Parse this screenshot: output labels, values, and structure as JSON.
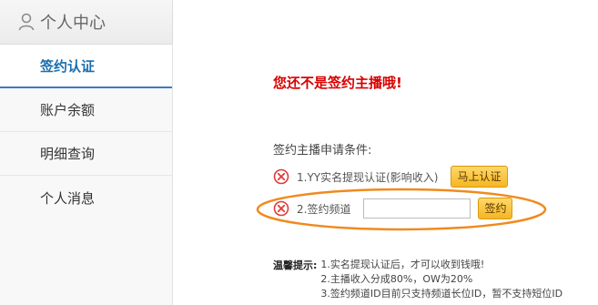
{
  "sidebar": {
    "header": {
      "icon": "user-icon",
      "title": "个人中心"
    },
    "items": [
      {
        "label": "签约认证",
        "active": true
      },
      {
        "label": "账户余额"
      },
      {
        "label": "明细查询"
      },
      {
        "label": "个人消息"
      }
    ]
  },
  "main": {
    "warning": "您还不是签约主播哦!",
    "conditions_label": "签约主播申请条件:",
    "conditions": [
      {
        "status_icon": "x-circle-icon",
        "text": "1.YY实名提现认证(影响收入)",
        "button": "马上认证"
      },
      {
        "status_icon": "x-circle-icon",
        "text": "2.签约频道",
        "input_value": "",
        "button": "签约"
      }
    ],
    "tips": {
      "title": "温馨提示:",
      "items": [
        "1.实名提现认证后，才可以收到钱哦!",
        "2.主播收入分成80%，OW为20%",
        "3.签约频道ID目前只支持频道长位ID，暂不支持短位ID"
      ]
    }
  },
  "colors": {
    "warning": "#d80000",
    "button_bg": "#f5b622",
    "highlight": "#f08a1d",
    "active_nav": "#1a6fb0"
  }
}
